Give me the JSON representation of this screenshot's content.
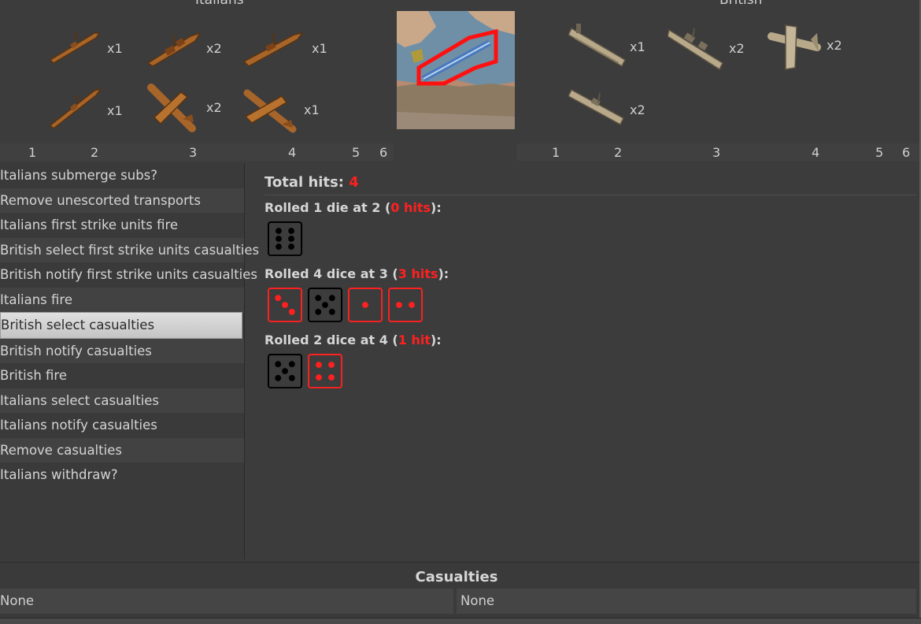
{
  "sides": {
    "attacker": "Italians",
    "defender": "British"
  },
  "italian_units": [
    {
      "icon": "destroyer-icon",
      "count": "x1"
    },
    {
      "icon": "battleship-icon",
      "count": "x2"
    },
    {
      "icon": "cruiser-icon",
      "count": "x1"
    },
    {
      "icon": "destroyer-icon",
      "count": "x1"
    },
    {
      "icon": "fighter-plane-icon",
      "count": "x2"
    },
    {
      "icon": "bomber-plane-icon",
      "count": "x1"
    }
  ],
  "british_units": [
    {
      "icon": "carrier-icon",
      "count": "x1"
    },
    {
      "icon": "battleship-icon",
      "count": "x2"
    },
    {
      "icon": "fighter-plane-icon",
      "count": "x2"
    },
    {
      "icon": "cruiser-icon",
      "count": "x2"
    }
  ],
  "scale_left": [
    "1",
    "2",
    "3",
    "4",
    "5",
    "6"
  ],
  "scale_right": [
    "1",
    "2",
    "3",
    "4",
    "5",
    "6"
  ],
  "steps": [
    "Italians submerge subs?",
    "Remove unescorted transports",
    "Italians first strike units fire",
    "British select first strike units casualties",
    "British notify first strike units casualties",
    "Italians fire",
    "British select casualties",
    "British notify casualties",
    "British fire",
    "Italians select casualties",
    "Italians notify casualties",
    "Remove casualties",
    "Italians withdraw?"
  ],
  "selected_step": "British select casualties",
  "results": {
    "total_label": "Total hits:",
    "total_value": "4",
    "rolls": [
      {
        "prefix": "Rolled 1 die at 2 (",
        "hits": "0 hits",
        "suffix": "):",
        "dice": [
          {
            "value": 6,
            "hit": false
          }
        ]
      },
      {
        "prefix": "Rolled 4 dice at 3 (",
        "hits": "3 hits",
        "suffix": "):",
        "dice": [
          {
            "value": 3,
            "hit": true
          },
          {
            "value": 5,
            "hit": false
          },
          {
            "value": 1,
            "hit": true
          },
          {
            "value": 2,
            "hit": true
          }
        ]
      },
      {
        "prefix": "Rolled 2 dice at 4 (",
        "hits": "1 hit",
        "suffix": "):",
        "dice": [
          {
            "value": 5,
            "hit": false
          },
          {
            "value": 4,
            "hit": true
          }
        ]
      }
    ]
  },
  "casualties": {
    "title": "Casualties",
    "left": "None",
    "right": "None"
  },
  "colors": {
    "hit": "#ff2020",
    "background": "#3c3c3c",
    "italian_unit": "#a8652a",
    "british_unit": "#b8a98a"
  }
}
